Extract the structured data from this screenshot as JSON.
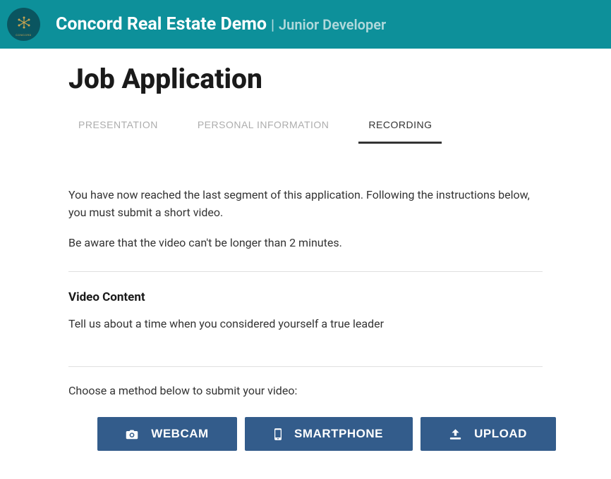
{
  "header": {
    "company_name": "Concord Real Estate Demo",
    "separator": "|",
    "job_title": "Junior Developer"
  },
  "page": {
    "title": "Job Application"
  },
  "tabs": [
    {
      "label": "PRESENTATION",
      "active": false
    },
    {
      "label": "PERSONAL INFORMATION",
      "active": false
    },
    {
      "label": "RECORDING",
      "active": true
    }
  ],
  "intro": {
    "paragraph1": "You have now reached the last segment of this application. Following the instructions below, you must submit a short video.",
    "paragraph2": "Be aware that the video can't be longer than 2 minutes."
  },
  "video_content": {
    "heading": "Video Content",
    "prompt": "Tell us about a time when you considered yourself a true leader"
  },
  "submit": {
    "choose_text": "Choose a method below to submit your video:",
    "buttons": {
      "webcam": "WEBCAM",
      "smartphone": "SMARTPHONE",
      "upload": "UPLOAD"
    }
  }
}
